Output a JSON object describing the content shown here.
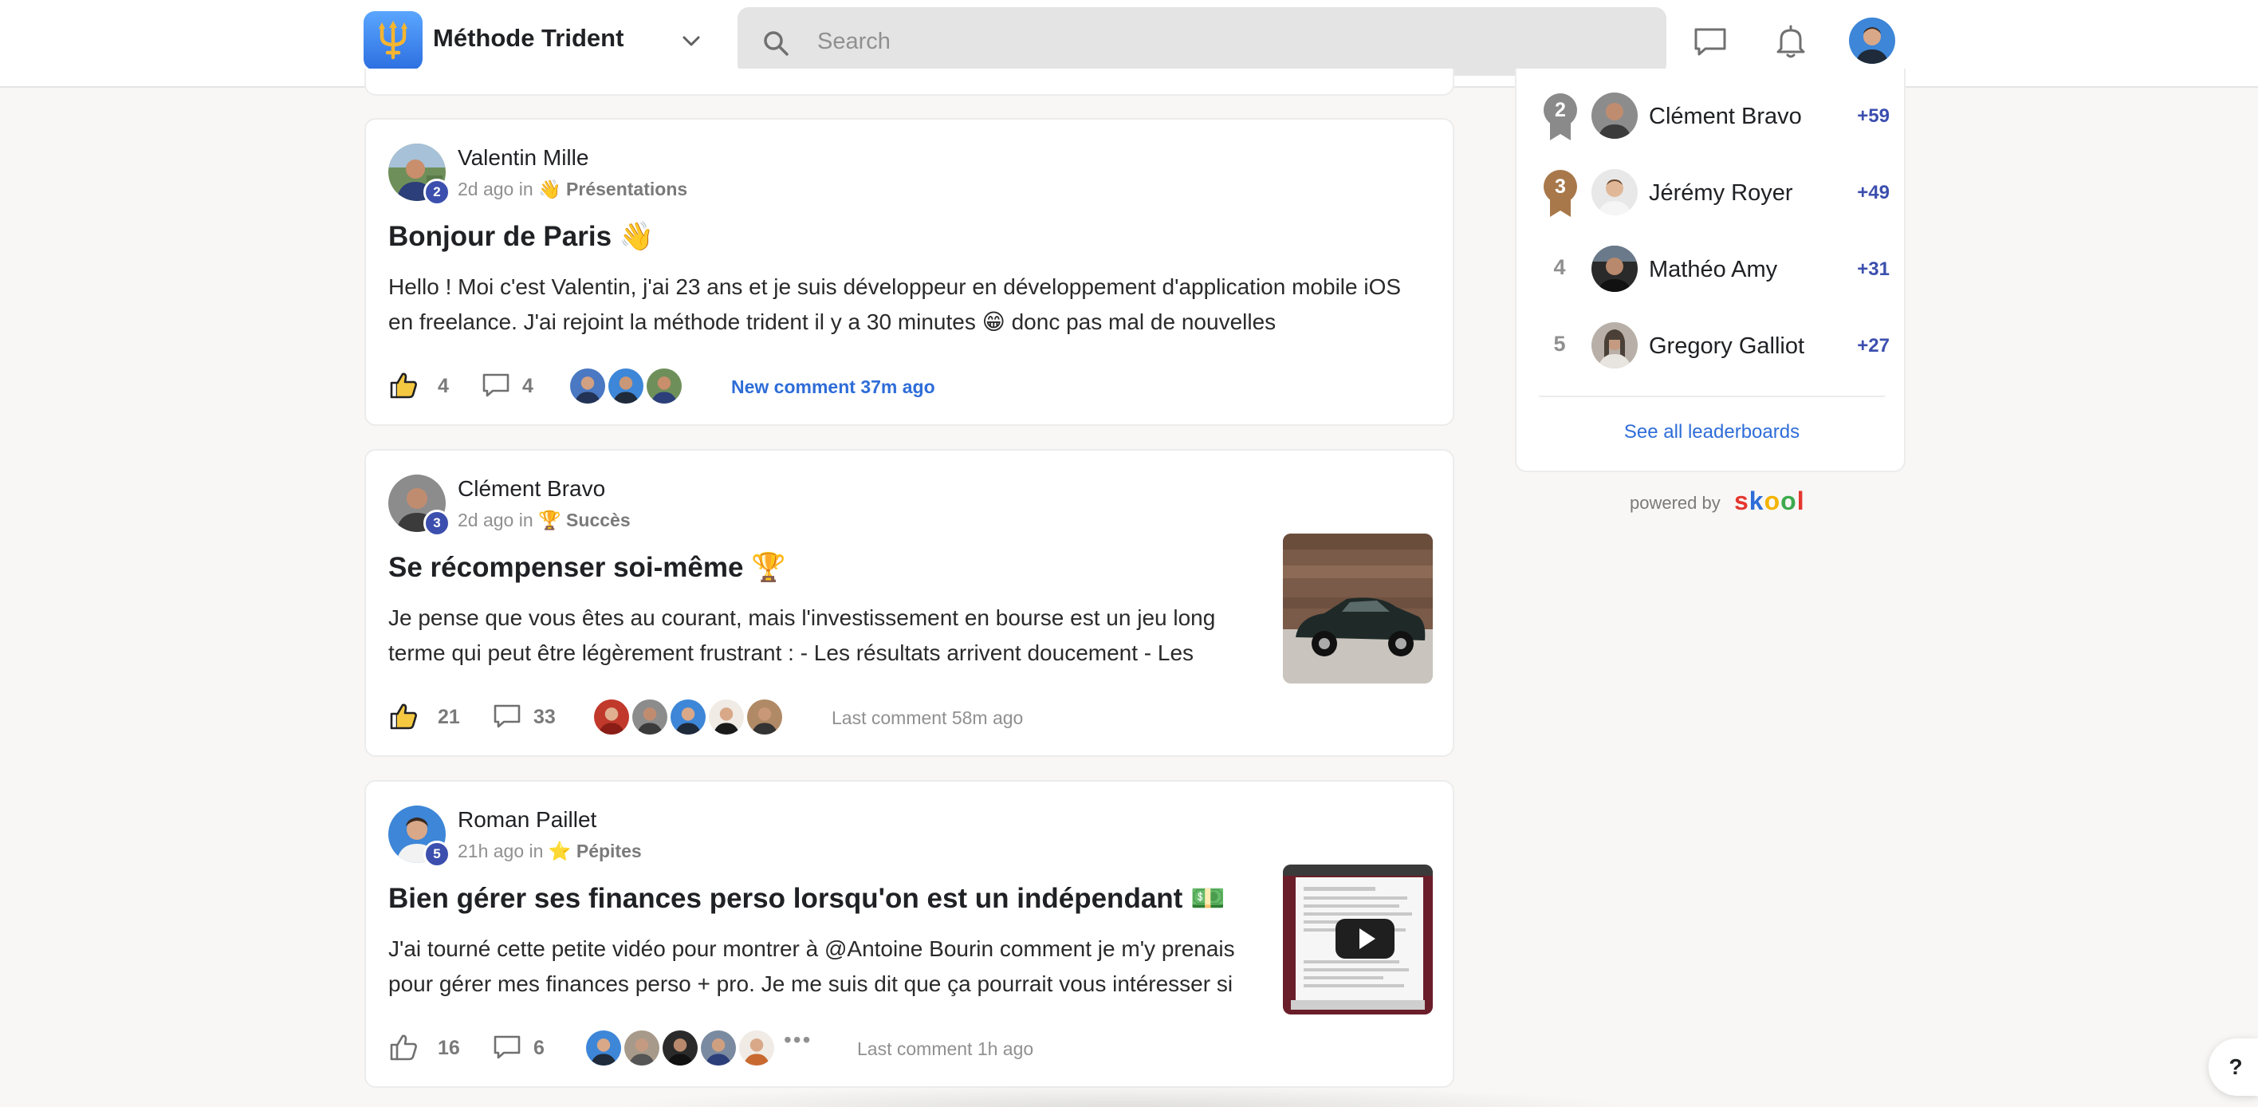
{
  "header": {
    "group_name": "Méthode Trident",
    "search_placeholder": "Search"
  },
  "posts": [
    {
      "author": "Valentin Mille",
      "level": "2",
      "time": "2d ago in",
      "category": "👋 Présentations",
      "title": "Bonjour de Paris 👋",
      "body": "Hello ! Moi c'est Valentin, j'ai 23 ans et je suis développeur en développement d'application mobile iOS en freelance. J'ai rejoint la méthode trident il y a 30 minutes 😁 donc pas mal de nouvelles",
      "likes": "4",
      "comments": "4",
      "comment_status": "New comment 37m ago"
    },
    {
      "author": "Clément Bravo",
      "level": "3",
      "time": "2d ago in",
      "category": "🏆 Succès",
      "title": "Se récompenser soi-même 🏆",
      "body": "Je pense que vous êtes au courant, mais l'investissement en bourse est un jeu long terme qui peut être légèrement frustrant : - Les résultats arrivent doucement - Les",
      "likes": "21",
      "comments": "33",
      "comment_status": "Last comment 58m ago"
    },
    {
      "author": "Roman Paillet",
      "level": "5",
      "time": "21h ago in",
      "category": "⭐ Pépites",
      "title": "Bien gérer ses finances perso lorsqu'on est un indépendant 💵",
      "body": "J'ai tourné cette petite vidéo pour montrer à @Antoine Bourin comment je m'y prenais pour gérer mes finances perso + pro. Je me suis dit que ça pourrait vous intéresser si",
      "likes": "16",
      "comments": "6",
      "comment_status": "Last comment 1h ago",
      "more": "•••"
    }
  ],
  "leaderboard": {
    "rows": [
      {
        "rank": "2",
        "name": "Clément Bravo",
        "points": "+59"
      },
      {
        "rank": "3",
        "name": "Jérémy Royer",
        "points": "+49"
      },
      {
        "rank": "4",
        "name": "Mathéo Amy",
        "points": "+31"
      },
      {
        "rank": "5",
        "name": "Gregory Galliot",
        "points": "+27"
      }
    ],
    "see_all": "See all leaderboards"
  },
  "footer": {
    "powered_by": "powered by",
    "brand": [
      "s",
      "k",
      "o",
      "o",
      "l"
    ]
  },
  "help": "?",
  "colors": {
    "accent": "#3c4fae",
    "link": "#2e6dd8",
    "brand": [
      "#e4372f",
      "#2e6dd8",
      "#f4b400",
      "#3daa4d",
      "#e4372f"
    ]
  }
}
